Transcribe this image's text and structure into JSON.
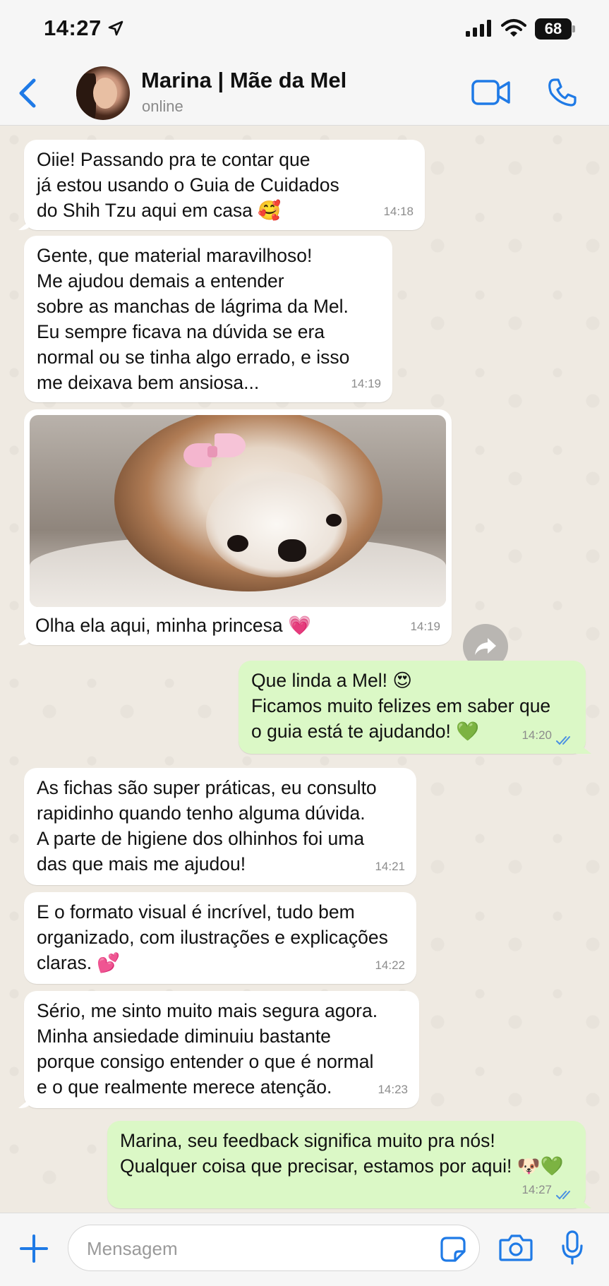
{
  "status_bar": {
    "time": "14:27",
    "battery": "68"
  },
  "header": {
    "contact_name": "Marina | Mãe da Mel",
    "contact_status": "online"
  },
  "messages": [
    {
      "dir": "in",
      "text": "Oiie! Passando pra te contar que\njá estou usando o Guia de Cuidados\ndo Shih Tzu aqui em casa 🥰",
      "time": "14:18"
    },
    {
      "dir": "in",
      "text": "Gente, que material maravilhoso!\nMe ajudou demais a entender\nsobre as manchas de lágrima da Mel.\nEu sempre ficava na dúvida se era\nnormal ou se tinha algo errado, e isso\nme deixava bem ansiosa...",
      "time": "14:19"
    },
    {
      "dir": "in",
      "type": "photo",
      "text": "Olha ela aqui, minha princesa 💗",
      "time": "14:19"
    },
    {
      "dir": "out",
      "text": "Que linda a Mel! 😍\nFicamos muito felizes em saber que\no guia está te ajudando! 💚",
      "time": "14:20"
    },
    {
      "dir": "in",
      "text": "As fichas são super práticas, eu consulto\nrapidinho quando tenho alguma dúvida.\nA parte de higiene dos olhinhos foi uma\ndas que mais me ajudou!",
      "time": "14:21"
    },
    {
      "dir": "in",
      "text": "E o formato visual é incrível, tudo bem\norganizado, com ilustrações e explicações\nclaras. 💕",
      "time": "14:22"
    },
    {
      "dir": "in",
      "text": "Sério, me sinto muito mais segura agora.\nMinha ansiedade diminuiu bastante\nporque consigo entender o que é normal\ne o que realmente merece atenção.",
      "time": "14:23"
    },
    {
      "dir": "out",
      "text": "Marina, seu feedback significa muito pra nós!\nQualquer coisa que precisar, estamos por aqui! 🐶💚",
      "time": "14:27"
    }
  ],
  "input": {
    "placeholder": "Mensagem"
  },
  "colors": {
    "accent": "#1f7ae6",
    "incoming_bubble": "#ffffff",
    "outgoing_bubble": "#dbf8c6",
    "chat_background": "#efeae2"
  },
  "icons": [
    "location-arrow-icon",
    "signal-icon",
    "wifi-icon",
    "back-chevron-icon",
    "video-call-icon",
    "phone-icon",
    "forward-icon",
    "plus-icon",
    "sticker-icon",
    "camera-icon",
    "microphone-icon",
    "double-check-icon"
  ]
}
